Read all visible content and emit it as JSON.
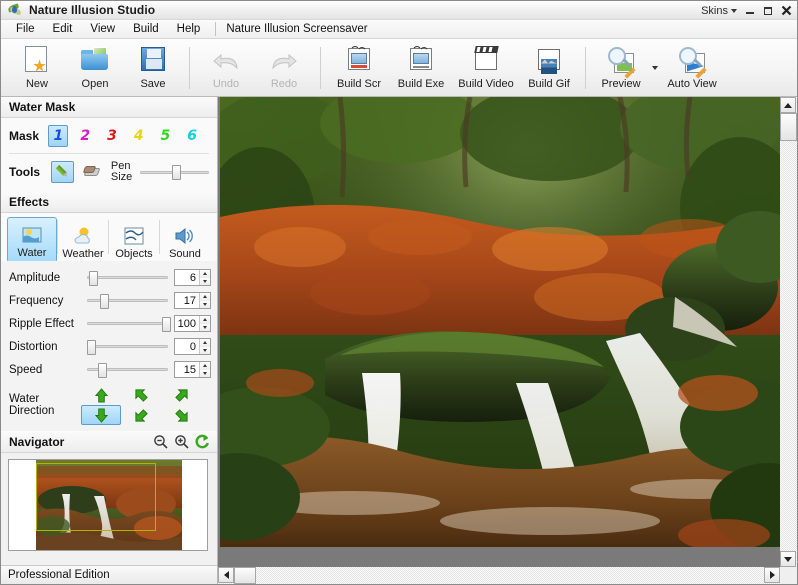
{
  "window": {
    "title": "Nature Illusion Studio",
    "app_icon": "leaf-water-icon",
    "skins_label": "Skins",
    "minimize": "minimize-button",
    "maximize": "maximize-button",
    "close": "close-button"
  },
  "menubar": {
    "items": [
      "File",
      "Edit",
      "View",
      "Build",
      "Help"
    ],
    "product_link": "Nature Illusion Screensaver"
  },
  "toolbar": {
    "groups": [
      {
        "buttons": [
          {
            "label": "New",
            "icon": "new-document-icon",
            "enabled": true
          },
          {
            "label": "Open",
            "icon": "open-folder-icon",
            "enabled": true
          },
          {
            "label": "Save",
            "icon": "floppy-disk-icon",
            "enabled": true
          }
        ]
      },
      {
        "buttons": [
          {
            "label": "Undo",
            "icon": "undo-arrow-icon",
            "enabled": false
          },
          {
            "label": "Redo",
            "icon": "redo-arrow-icon",
            "enabled": false
          }
        ]
      },
      {
        "buttons": [
          {
            "label": "Build Scr",
            "icon": "screensaver-icon",
            "enabled": true
          },
          {
            "label": "Build Exe",
            "icon": "executable-icon",
            "enabled": true
          },
          {
            "label": "Build Video",
            "icon": "clapperboard-icon",
            "enabled": true
          },
          {
            "label": "Build Gif",
            "icon": "picture-icon",
            "enabled": true
          }
        ]
      },
      {
        "buttons": [
          {
            "label": "Preview",
            "icon": "preview-magnifier-icon",
            "enabled": true,
            "has_dropdown": true
          },
          {
            "label": "Auto View",
            "icon": "auto-view-icon",
            "enabled": true
          }
        ]
      }
    ]
  },
  "water_mask": {
    "title": "Water Mask",
    "mask_label": "Mask",
    "masks": [
      {
        "number": "1",
        "color": "#1a50d8",
        "selected": true
      },
      {
        "number": "2",
        "color": "#d81ac8",
        "selected": false
      },
      {
        "number": "3",
        "color": "#d81a1a",
        "selected": false
      },
      {
        "number": "4",
        "color": "#e8d413",
        "selected": false
      },
      {
        "number": "5",
        "color": "#2fd81a",
        "selected": false
      },
      {
        "number": "6",
        "color": "#13cfd8",
        "selected": false
      }
    ],
    "tools_label": "Tools",
    "tools": [
      {
        "name": "pen-tool",
        "selected": true
      },
      {
        "name": "eraser-tool",
        "selected": false
      }
    ],
    "pen_size_label_line1": "Pen",
    "pen_size_label_line2": "Size",
    "pen_size_percent": 50
  },
  "effects": {
    "title": "Effects",
    "tabs": [
      {
        "label": "Water",
        "icon": "water-icon",
        "selected": true
      },
      {
        "label": "Weather",
        "icon": "weather-sun-cloud-icon",
        "selected": false
      },
      {
        "label": "Objects",
        "icon": "objects-icon",
        "selected": false
      },
      {
        "label": "Sound",
        "icon": "speaker-icon",
        "selected": false
      }
    ],
    "sliders": [
      {
        "label": "Amplitude",
        "value": "6",
        "percent": 6
      },
      {
        "label": "Frequency",
        "value": "17",
        "percent": 17
      },
      {
        "label": "Ripple Effect",
        "value": "100",
        "percent": 100
      },
      {
        "label": "Distortion",
        "value": "0",
        "percent": 0
      },
      {
        "label": "Speed",
        "value": "15",
        "percent": 15
      }
    ],
    "direction_label_line1": "Water",
    "direction_label_line2": "Direction",
    "directions": [
      {
        "name": "direction-up",
        "glyph": "up",
        "selected": false
      },
      {
        "name": "direction-up-left",
        "glyph": "up-left",
        "selected": false
      },
      {
        "name": "direction-up-right",
        "glyph": "up-right",
        "selected": false
      },
      {
        "name": "direction-down",
        "glyph": "down",
        "selected": true
      },
      {
        "name": "direction-down-left",
        "glyph": "down-left",
        "selected": false
      },
      {
        "name": "direction-down-right",
        "glyph": "down-right",
        "selected": false
      }
    ],
    "arrow_color": "#3aa81e"
  },
  "navigator": {
    "title": "Navigator",
    "zoom_out": "zoom-out-icon",
    "zoom_in": "zoom-in-icon",
    "reset": "refresh-icon"
  },
  "statusbar": {
    "edition": "Professional Edition"
  },
  "canvas": {
    "image_alt": "forest-waterfall-autumn-leaves",
    "vscroll_thumb_top_percent": 2,
    "hscroll_thumb_left_percent": 1
  }
}
